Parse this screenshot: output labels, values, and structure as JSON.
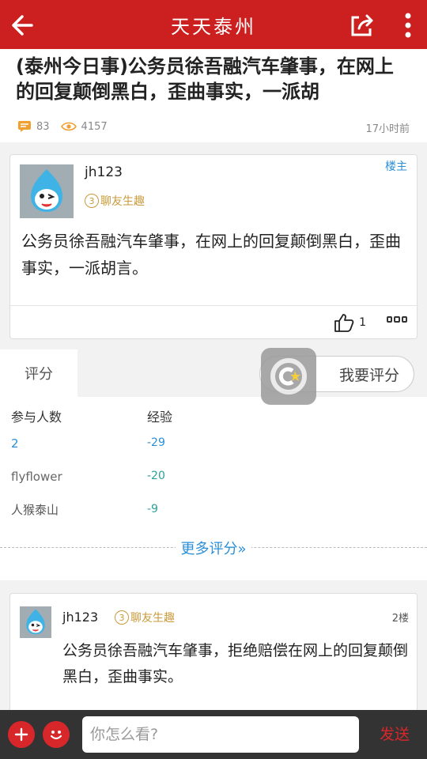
{
  "header": {
    "title": "天天泰州"
  },
  "article": {
    "title": "(泰州今日事)公务员徐吾融汽车肇事，在网上的回复颠倒黑白，歪曲事实，一派胡",
    "comments": "83",
    "views": "4157",
    "time": "17小时前"
  },
  "post1": {
    "username": "jh123",
    "badge_level": "3",
    "badge_label": "聊友生趣",
    "owner_label": "楼主",
    "body": "公务员徐吾融汽车肇事，在网上的回复颠倒黑白，歪曲事实，一派胡言。",
    "likes": "1"
  },
  "rating": {
    "tab": "评分",
    "button": "我要评分",
    "col_people": "参与人数",
    "col_exp": "经验",
    "rows": [
      {
        "name": "2",
        "value": "-29"
      },
      {
        "name": "flyflower",
        "value": "-20"
      },
      {
        "name": "人猴泰山",
        "value": "-9"
      }
    ],
    "more": "更多评分»"
  },
  "post2": {
    "username": "jh123",
    "badge_level": "3",
    "badge_label": "聊友生趣",
    "floor": "2楼",
    "body": "公务员徐吾融汽车肇事，拒绝赔偿在网上的回复颠倒黑白，歪曲事实。"
  },
  "bottom": {
    "placeholder": "你怎么看?",
    "send": "发送"
  },
  "colors": {
    "primary": "#cc1f1f",
    "link": "#2a8fd6",
    "badge": "#c89a3b",
    "positive_value": "#2aa198"
  }
}
